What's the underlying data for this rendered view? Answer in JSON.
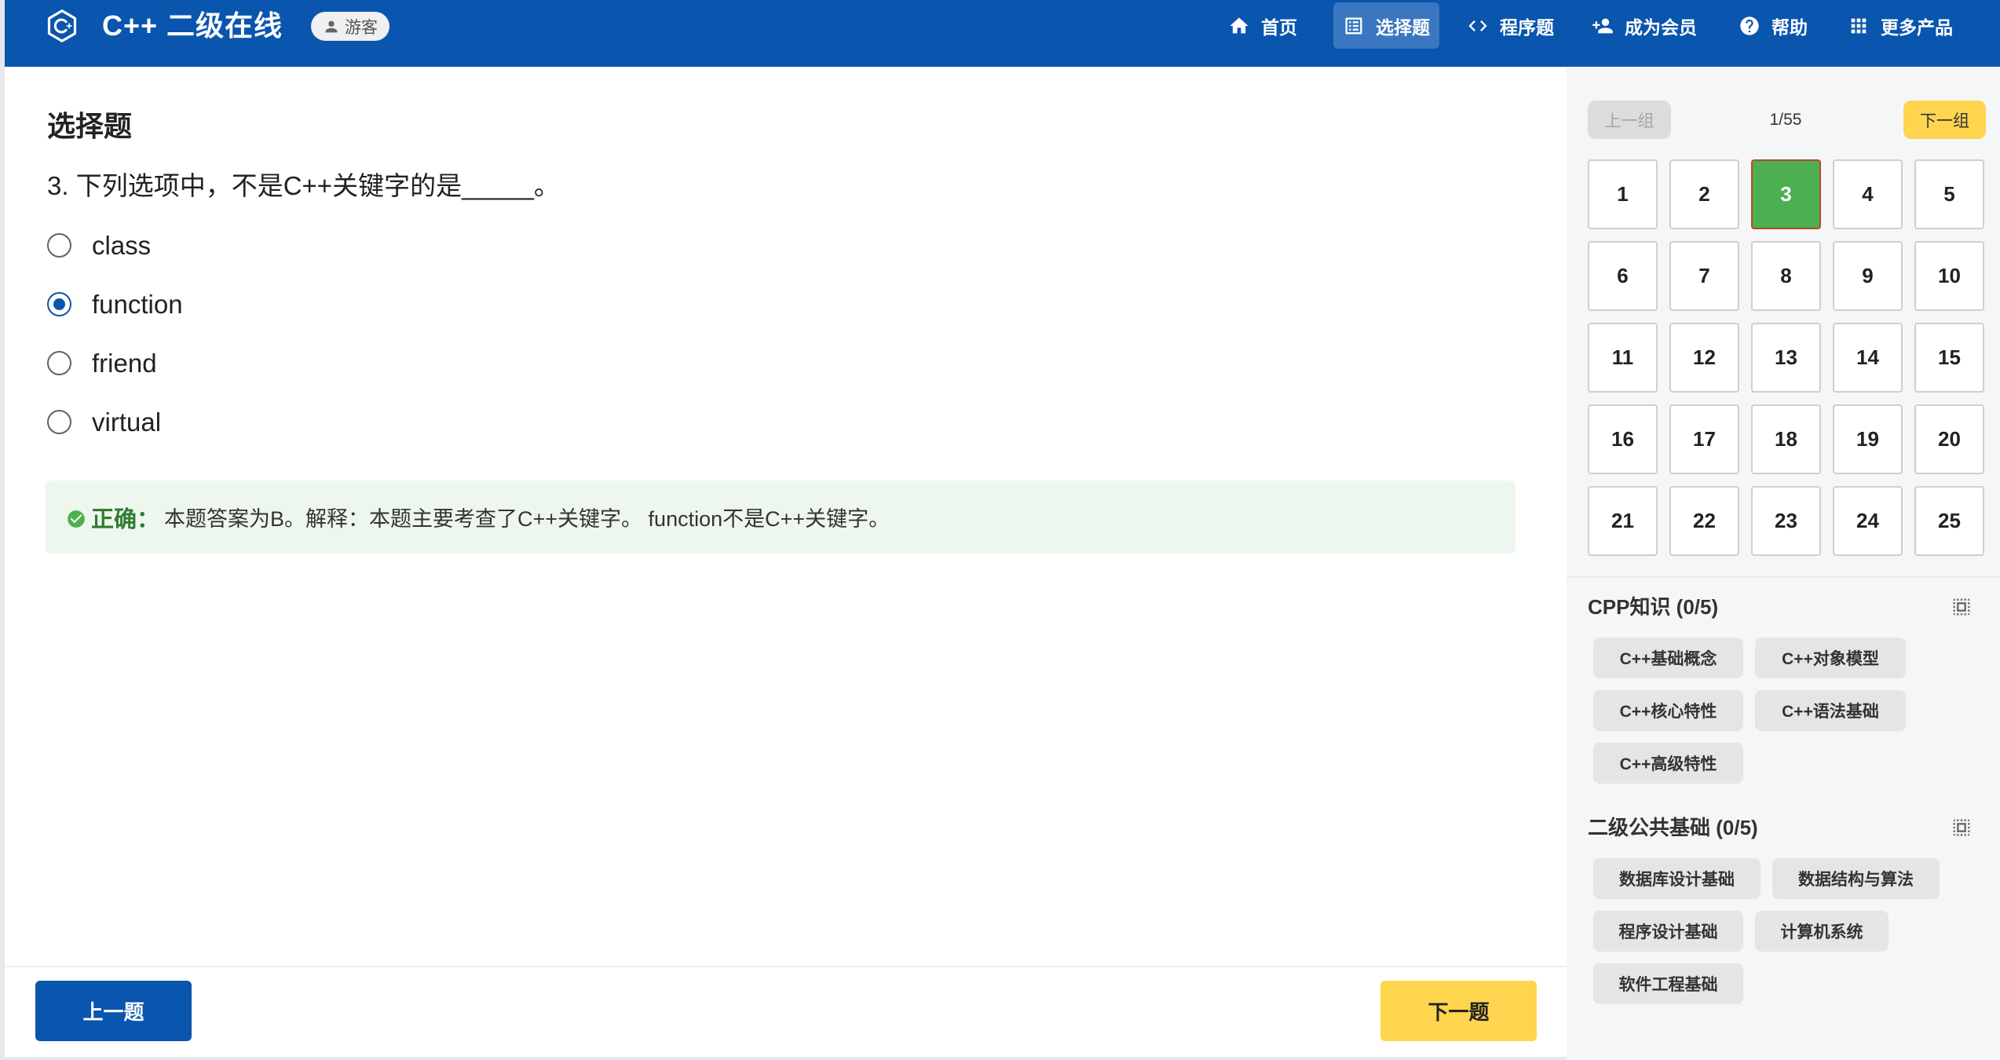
{
  "header": {
    "title": "C++ 二级在线",
    "badge": "游客",
    "logo_icon": "cpp-logo-icon",
    "nav": [
      {
        "label": "首页",
        "icon": "home-icon",
        "active": false
      },
      {
        "label": "选择题",
        "icon": "list-icon",
        "active": true
      },
      {
        "label": "程序题",
        "icon": "code-icon",
        "active": false
      },
      {
        "label": "成为会员",
        "icon": "add-user-icon",
        "active": false
      },
      {
        "label": "帮助",
        "icon": "help-icon",
        "active": false
      },
      {
        "label": "更多产品",
        "icon": "apps-grid-icon",
        "active": false
      }
    ]
  },
  "question": {
    "section_title": "选择题",
    "text": "3. 下列选项中，不是C++关键字的是_____。",
    "options": [
      {
        "label": "class",
        "selected": false
      },
      {
        "label": "function",
        "selected": true
      },
      {
        "label": "friend",
        "selected": false
      },
      {
        "label": "virtual",
        "selected": false
      }
    ],
    "feedback": {
      "status": "正确：",
      "text": "本题答案为B。解释：本题主要考查了C++关键字。 function不是C++关键字。",
      "icon": "check-circle-icon"
    }
  },
  "footer": {
    "prev_label": "上一题",
    "next_label": "下一题"
  },
  "sidebar": {
    "prev_group": "上一组",
    "page": "1/55",
    "next_group": "下一组",
    "current": "3",
    "numbers": [
      "1",
      "2",
      "3",
      "4",
      "5",
      "6",
      "7",
      "8",
      "9",
      "10",
      "11",
      "12",
      "13",
      "14",
      "15",
      "16",
      "17",
      "18",
      "19",
      "20",
      "21",
      "22",
      "23",
      "24",
      "25"
    ],
    "categories": [
      {
        "title": "CPP知识 (0/5)",
        "icon": "select-all-icon",
        "tags": [
          "C++基础概念",
          "C++对象模型",
          "C++核心特性",
          "C++语法基础",
          "C++高级特性"
        ]
      },
      {
        "title": "二级公共基础 (0/5)",
        "icon": "select-all-icon",
        "tags": [
          "数据库设计基础",
          "数据结构与算法",
          "程序设计基础",
          "计算机系统",
          "软件工程基础"
        ]
      }
    ]
  },
  "colors": {
    "brand": "#0a55ad",
    "accent": "#ffd54f",
    "success": "#4caf50",
    "success_text": "#2e7d32",
    "feedback_bg": "#edf7ee"
  }
}
